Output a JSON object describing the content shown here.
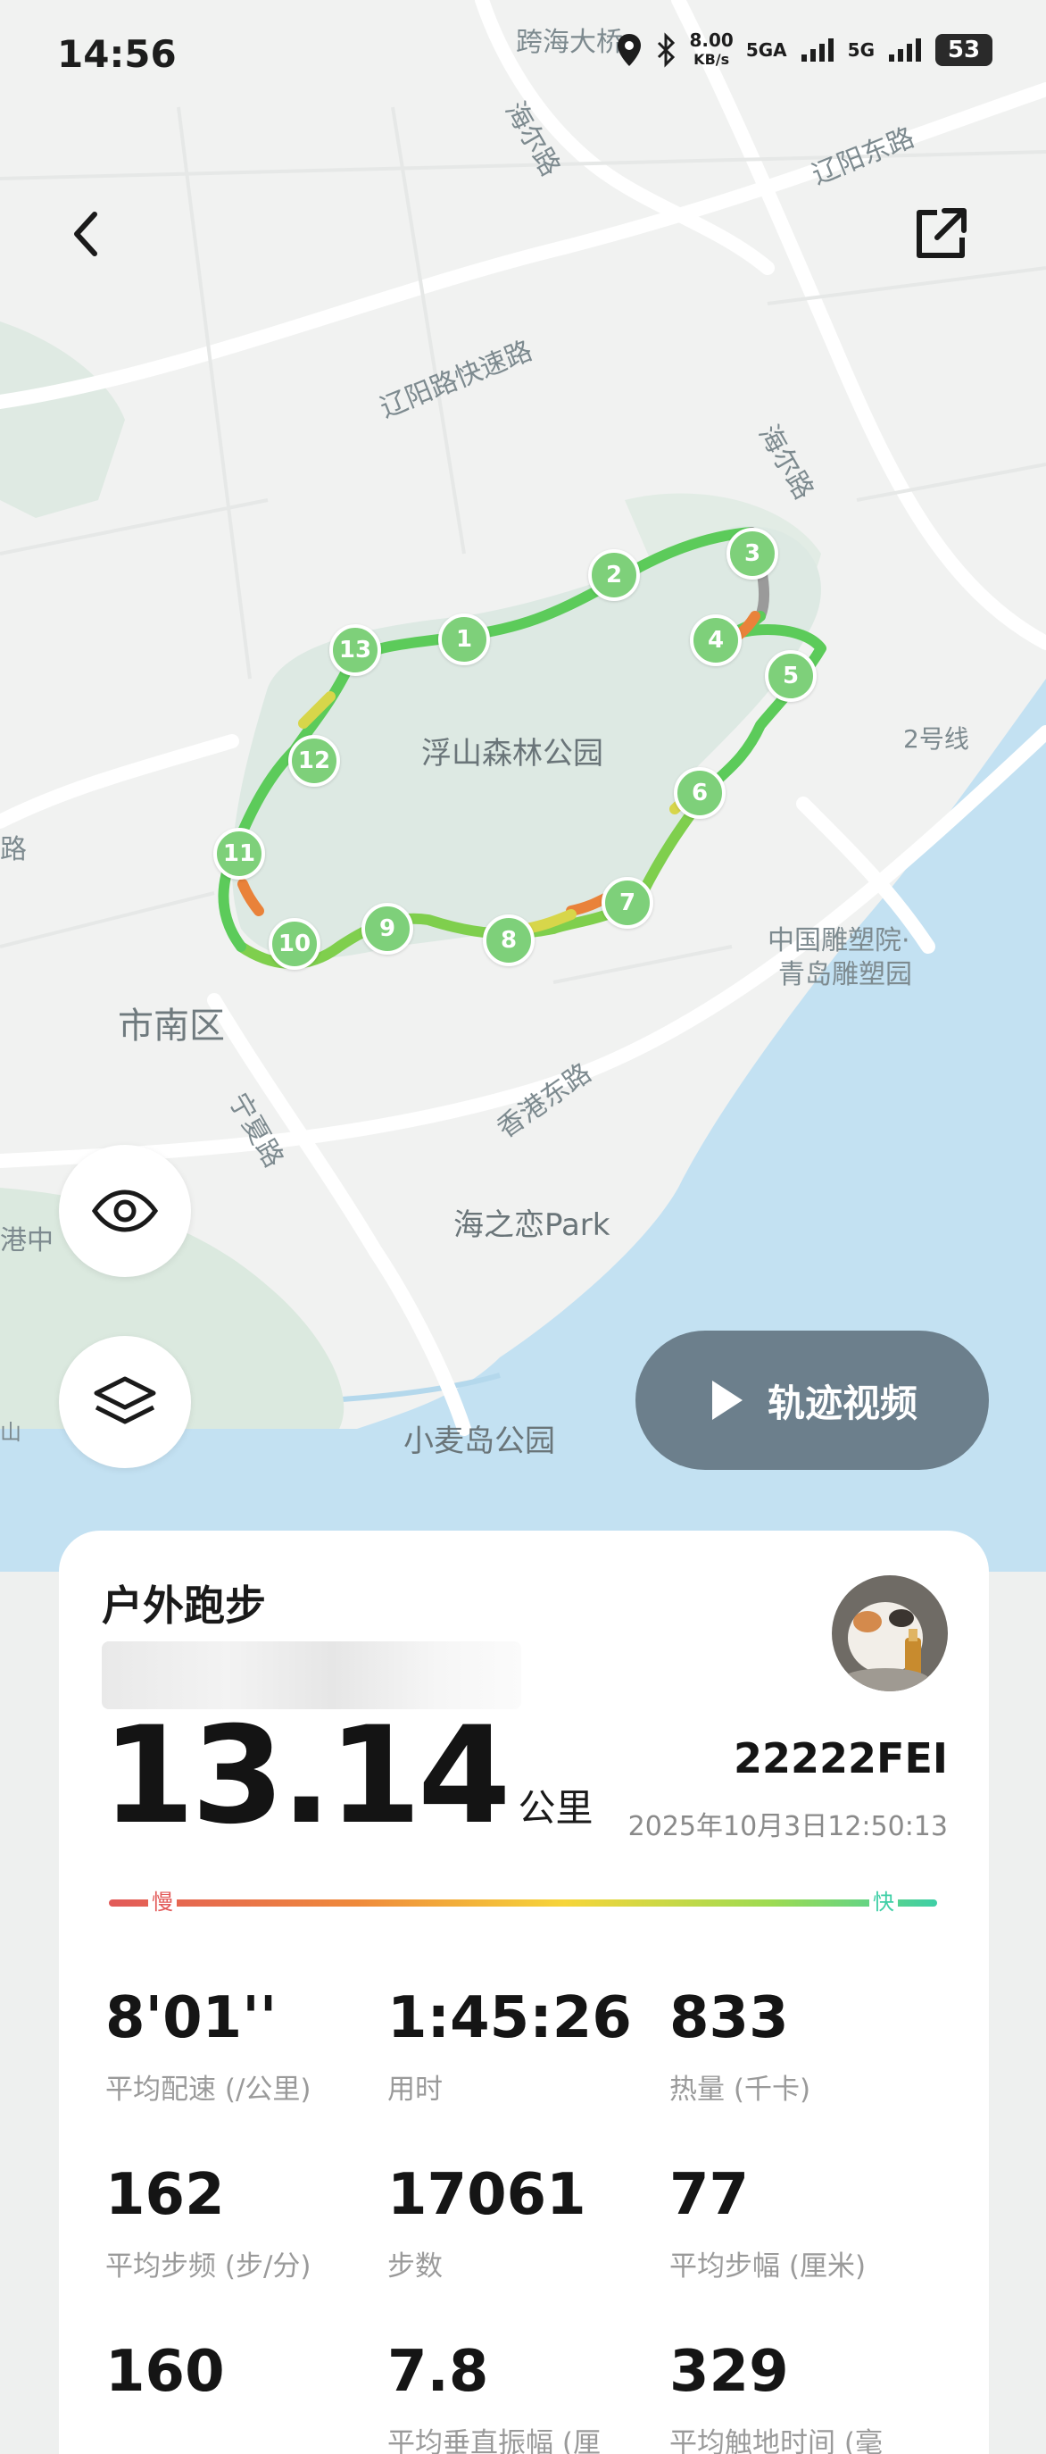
{
  "status_bar": {
    "time": "14:56",
    "net_speed_value": "8.00",
    "net_speed_unit": "KB/s",
    "sim1": "5GA",
    "sim2": "5G",
    "battery": "53"
  },
  "map": {
    "labels": {
      "road_kuahai": "跨海大桥",
      "road_haier_top": "海尔路",
      "road_liaoyang_east": "辽阳东路",
      "road_liaoyang_express": "辽阳路快速路",
      "road_haier_right": "海尔路",
      "park_fushan": "浮山森林公园",
      "line2": "2号线",
      "sculpture_1": "中国雕塑院·",
      "sculpture_2": "青岛雕塑园",
      "district_shinan": "市南区",
      "road_ningxia": "宁夏路",
      "road_xianggang_east": "香港东路",
      "park_haizhilian": "海之恋Park",
      "park_xiaomaidao": "小麦岛公园",
      "edge_gangzhong": "港中",
      "edge_lu": "路",
      "edge_left": "山"
    },
    "km_markers": [
      "1",
      "2",
      "3",
      "4",
      "5",
      "6",
      "7",
      "8",
      "9",
      "10",
      "11",
      "12",
      "13"
    ]
  },
  "buttons": {
    "back_icon": "chevron-left-icon",
    "share_icon": "external-link-icon",
    "visibility_icon": "eye-icon",
    "layers_icon": "layers-icon",
    "track_video_label": "轨迹视频"
  },
  "summary": {
    "activity_type": "户外跑步",
    "distance": "13.14",
    "distance_unit": "公里",
    "username": "22222FEI",
    "datetime": "2025年10月3日12:50:13",
    "pace_slow": "慢",
    "pace_fast": "快"
  },
  "stats": [
    {
      "value": "8'01''",
      "label": "平均配速 (/公里)"
    },
    {
      "value": "1:45:26",
      "label": "用时"
    },
    {
      "value": "833",
      "label": "热量 (千卡)"
    },
    {
      "value": "162",
      "label": "平均步频 (步/分)"
    },
    {
      "value": "17061",
      "label": "步数"
    },
    {
      "value": "77",
      "label": "平均步幅 (厘米)"
    },
    {
      "value": "160",
      "label": ""
    },
    {
      "value": "7.8",
      "label": "平均垂直振幅 (厘"
    },
    {
      "value": "329",
      "label": "平均触地时间 (毫"
    }
  ],
  "colors": {
    "route_fast": "#5ccb5a",
    "route_mid": "#d7d64a",
    "route_slow": "#e9823a",
    "marker": "#7ed07a",
    "sea": "#bfe0f1",
    "park": "#dde9e3",
    "video_button": "#6c7f8c"
  }
}
